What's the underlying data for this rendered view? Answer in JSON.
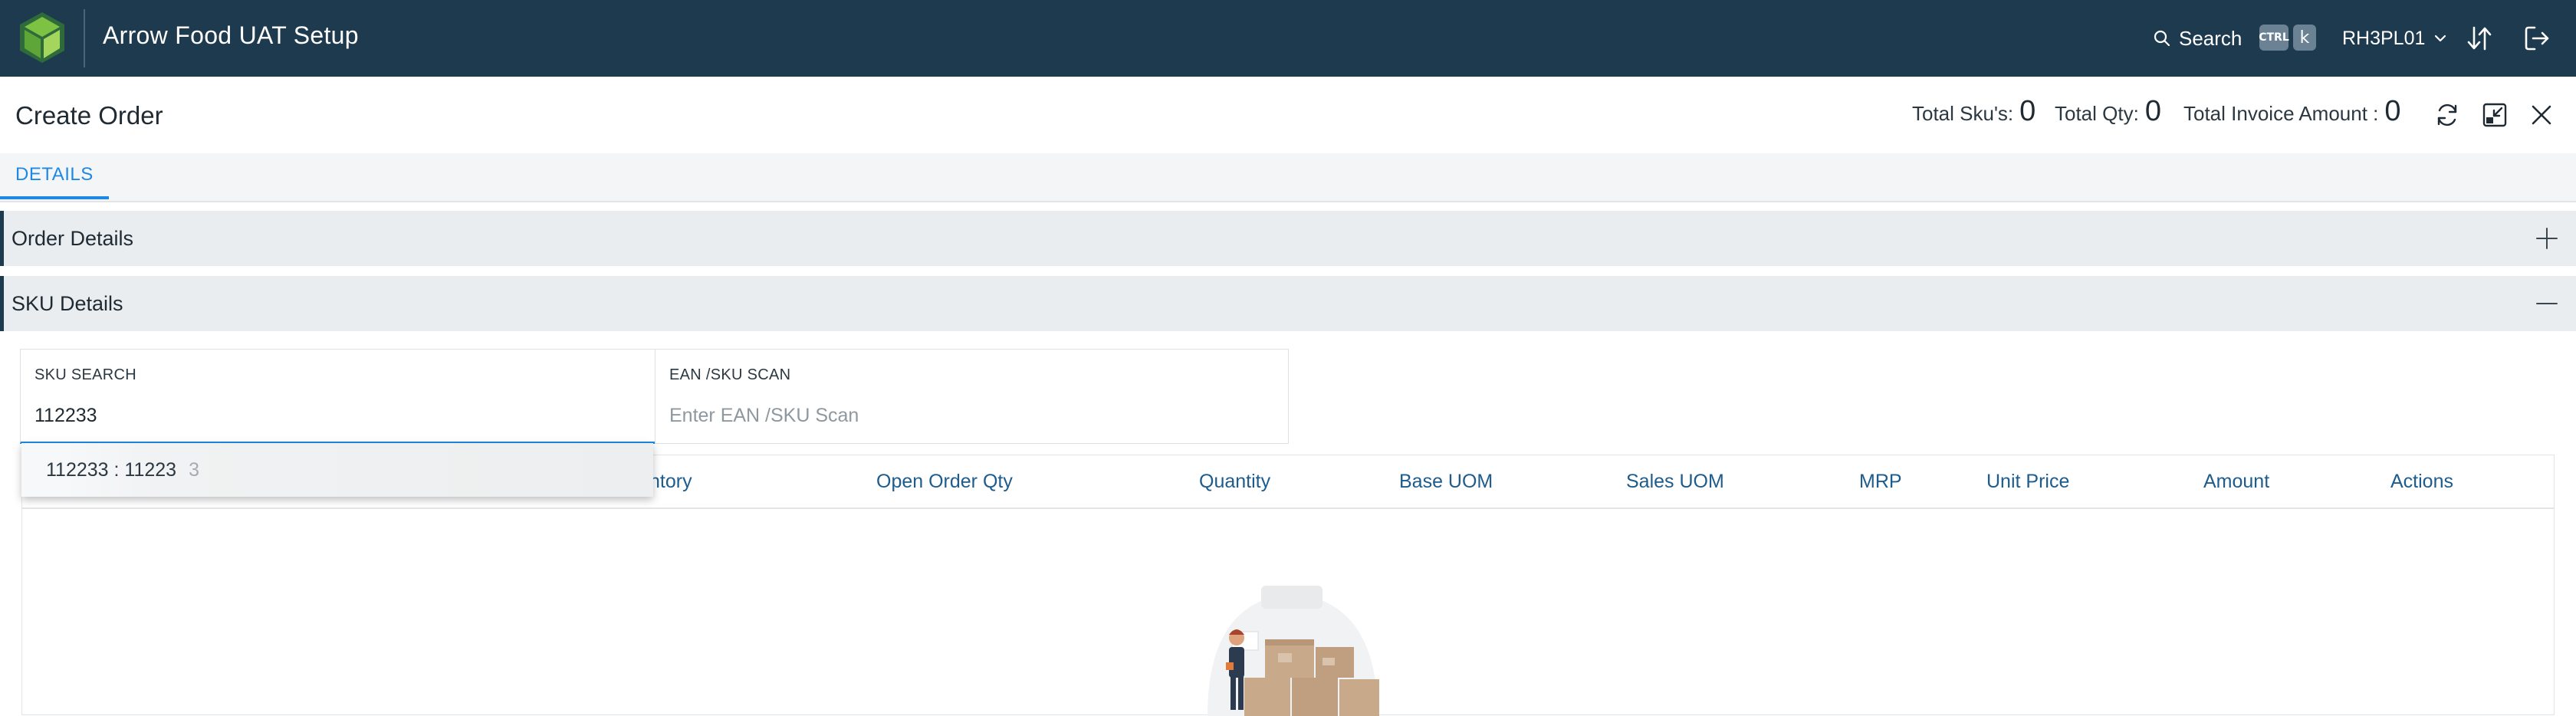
{
  "app": {
    "title": "Arrow Food UAT Setup",
    "search_label": "Search",
    "shortcut_ctrl": "CTRL",
    "shortcut_key": "k",
    "user": "RH3PL01",
    "colors": {
      "topbar": "#1d3a4e",
      "accent": "#1e88e5",
      "logo_green": "#7dc242"
    }
  },
  "page": {
    "title": "Create Order",
    "totals": [
      {
        "label": "Total Sku's:",
        "value": "0"
      },
      {
        "label": "Total Qty:",
        "value": "0"
      },
      {
        "label": "Total Invoice Amount :",
        "value": "0"
      }
    ]
  },
  "tabs": [
    {
      "label": "DETAILS",
      "active": true
    }
  ],
  "sections": {
    "order_details": {
      "title": "Order Details",
      "expanded": false
    },
    "sku_details": {
      "title": "SKU Details",
      "expanded": true
    }
  },
  "form": {
    "sku_search": {
      "label": "SKU SEARCH",
      "value": "112233"
    },
    "ean_scan": {
      "label": "EAN /SKU SCAN",
      "placeholder": "Enter EAN /SKU Scan"
    }
  },
  "dropdown": {
    "items": [
      {
        "text": "112233 : 11223",
        "faded_tail": "3"
      }
    ]
  },
  "table": {
    "columns": [
      "ntory",
      "Open Order Qty",
      "Quantity",
      "Base UOM",
      "Sales UOM",
      "MRP",
      "Unit Price",
      "Amount",
      "Actions"
    ],
    "rows": []
  },
  "icons": {
    "search": "search-icon",
    "user_menu": "chevron-down-icon",
    "sort": "sort-icon",
    "logout": "logout-icon",
    "refresh": "refresh-icon",
    "minimize": "minimize-icon",
    "close": "close-icon",
    "expand": "plus-icon",
    "collapse": "minus-icon"
  }
}
